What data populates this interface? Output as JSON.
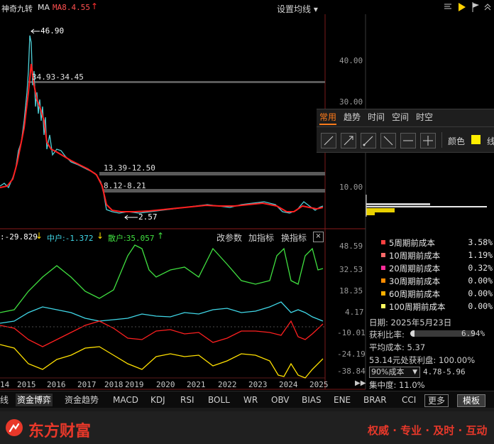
{
  "header": {
    "ma_label": "MA",
    "ma_value": "MA8.4.55",
    "settings_label": "设置均线"
  },
  "main_chart": {
    "title_prefix": "神奇九转",
    "price_axis": [
      "40.00",
      "30.00",
      "10.00"
    ],
    "high_label": "46.90",
    "low_label": "2.57",
    "zones": [
      {
        "label": "34.93-34.45"
      },
      {
        "label": "13.39-12.50"
      },
      {
        "label": "8.12-8.21"
      }
    ]
  },
  "indicator": {
    "main_force": "-29.829",
    "mid_label": "中户:",
    "mid_value": "-1.372",
    "retail_label": "散户:",
    "retail_value": "35.057",
    "change_param": "改参数",
    "add_indicator": "加指标",
    "swap_indicator": "换指标",
    "axis": [
      "48.59",
      "32.53",
      "18.35",
      "4.17",
      "-10.01",
      "-24.19",
      "-38.84"
    ]
  },
  "years": [
    "14",
    "2015",
    "2016",
    "2017",
    "2018",
    "2019",
    "2020",
    "2021",
    "2022",
    "2023",
    "2024",
    "2025"
  ],
  "draw_panel": {
    "tabs": [
      "常用",
      "趋势",
      "时间",
      "空间",
      "时空"
    ],
    "color_label": "颜色",
    "line_label": "线",
    "tool_icons": [
      "line-up-icon",
      "line-up2-icon",
      "line-diag-icon",
      "line-down-icon",
      "hline-icon",
      "plus-icon"
    ]
  },
  "cost": {
    "rows": [
      {
        "name": "5周期前成本",
        "value": "3.58%",
        "color": "#ff4040"
      },
      {
        "name": "10周期前成本",
        "value": "1.19%",
        "color": "#ff6a6a"
      },
      {
        "name": "20周期前成本",
        "value": "0.32%",
        "color": "#ff2d9a"
      },
      {
        "name": "30周期前成本",
        "value": "0.00%",
        "color": "#ff8c00"
      },
      {
        "name": "60周期前成本",
        "value": "0.00%",
        "color": "#ffb000"
      },
      {
        "name": "100周期前成本",
        "value": "0.00%",
        "color": "#ffff60"
      }
    ],
    "date_label": "日期: 2025年5月23日",
    "profit_label": "获利比率:",
    "profit_value": "6.94%",
    "profit_fraction": 0.0694,
    "avg_label": "平均成本: 5.37",
    "profit_at_label": "53.14元处获利盘: 100.00%",
    "select_value": "90%成本",
    "range_value": "4.78-5.96",
    "concentration": "集中度: 11.0%"
  },
  "tabs": [
    "线",
    "资金博弈",
    "资金趋势",
    "MACD",
    "KDJ",
    "RSI",
    "BOLL",
    "WR",
    "OBV",
    "BIAS",
    "ENE",
    "BRAR",
    "CCI"
  ],
  "more_label": "更多",
  "template_label": "模板",
  "brand": {
    "name": "东方财富",
    "slogan": "权威 · 专业 · 及时 · 互动"
  }
}
